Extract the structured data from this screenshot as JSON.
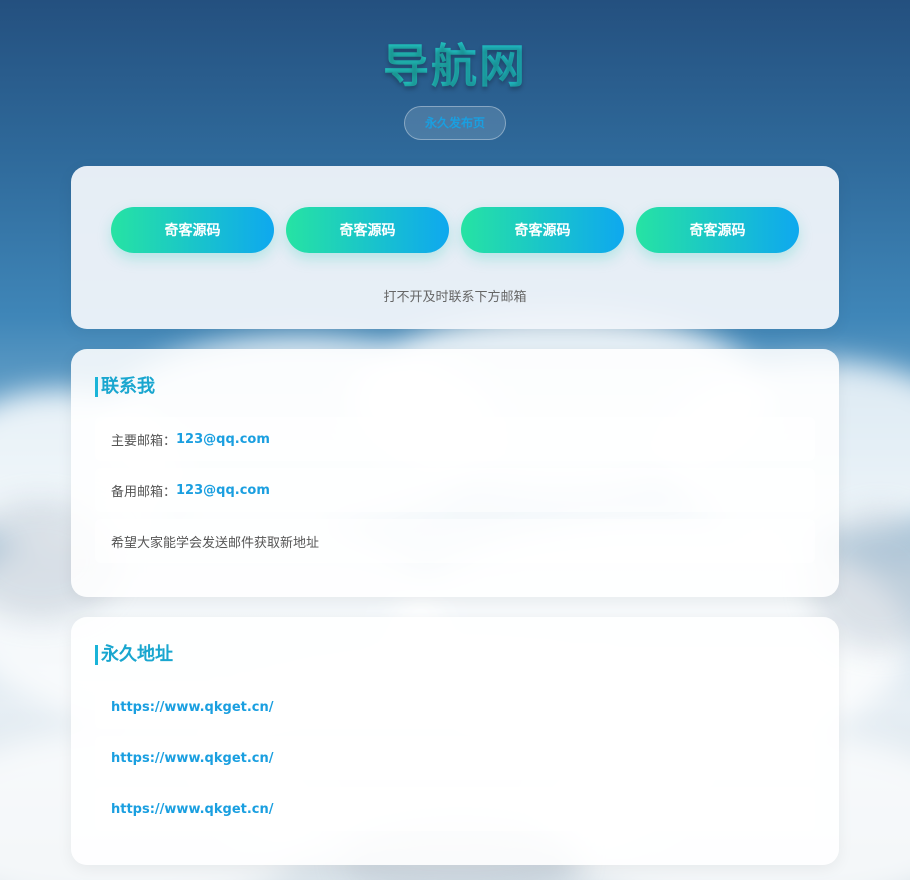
{
  "header": {
    "title": "导航网",
    "pill_label": "永久发布页"
  },
  "nav": {
    "buttons": [
      "奇客源码",
      "奇客源码",
      "奇客源码",
      "奇客源码"
    ],
    "note": "打不开及时联系下方邮箱"
  },
  "contact": {
    "title": "联系我",
    "rows": [
      {
        "label": "主要邮箱：",
        "value": "123@qq.com"
      },
      {
        "label": "备用邮箱：",
        "value": "123@qq.com"
      }
    ],
    "message": "希望大家能学会发送邮件获取新地址"
  },
  "addresses": {
    "title": "永久地址",
    "links": [
      "https://www.qkget.cn/",
      "https://www.qkget.cn/",
      "https://www.qkget.cn/"
    ]
  },
  "colors": {
    "accent": "#1a9fe0",
    "gradient_start": "#26e3a3",
    "gradient_end": "#0ea8ef"
  }
}
